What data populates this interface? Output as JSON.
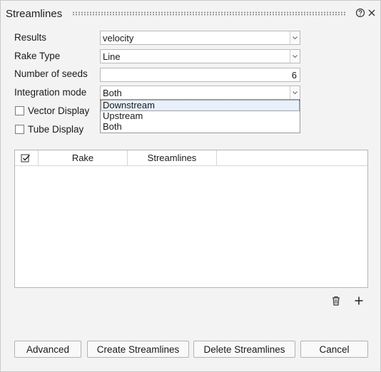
{
  "panel": {
    "title": "Streamlines",
    "help_icon": "help-circle-icon",
    "close_icon": "close-icon"
  },
  "form": {
    "results": {
      "label": "Results",
      "value": "velocity"
    },
    "rake_type": {
      "label": "Rake Type",
      "value": "Line"
    },
    "number_of_seeds": {
      "label": "Number of seeds",
      "value": "6"
    },
    "integration_mode": {
      "label": "Integration mode",
      "value": "Both",
      "options": [
        "Downstream",
        "Upstream",
        "Both"
      ],
      "highlighted": "Downstream"
    },
    "vector_display": {
      "label": "Vector Display",
      "checked": false
    },
    "tube_display": {
      "label": "Tube Display",
      "checked": false
    }
  },
  "table": {
    "columns": [
      "Rake",
      "Streamlines"
    ],
    "select_all_icon": "checkbox-checked-icon",
    "rows": []
  },
  "table_actions": {
    "delete_icon": "trash-icon",
    "add_icon": "plus-icon"
  },
  "buttons": {
    "advanced": "Advanced",
    "create": "Create Streamlines",
    "delete": "Delete Streamlines",
    "cancel": "Cancel"
  }
}
